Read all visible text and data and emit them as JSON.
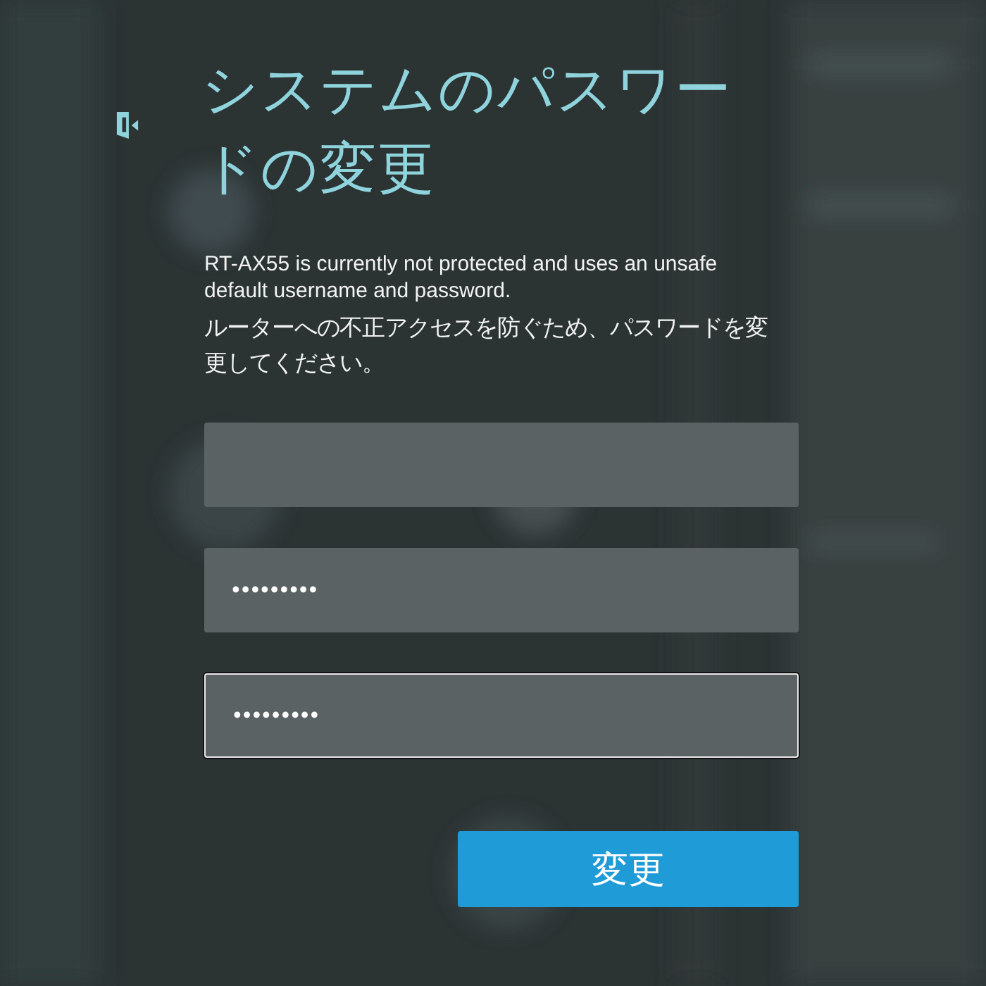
{
  "dialog": {
    "title": "システムのパスワードの変更",
    "message": "RT-AX55 is currently not protected and uses an unsafe default username and password.",
    "instruction": "ルーターへの不正アクセスを防ぐため、パスワードを変更してください。",
    "fields": [
      {
        "focused": false
      },
      {
        "value": "•••••••••",
        "focused": false
      },
      {
        "value": "•••••••••",
        "focused": true
      }
    ],
    "button": "変更"
  }
}
